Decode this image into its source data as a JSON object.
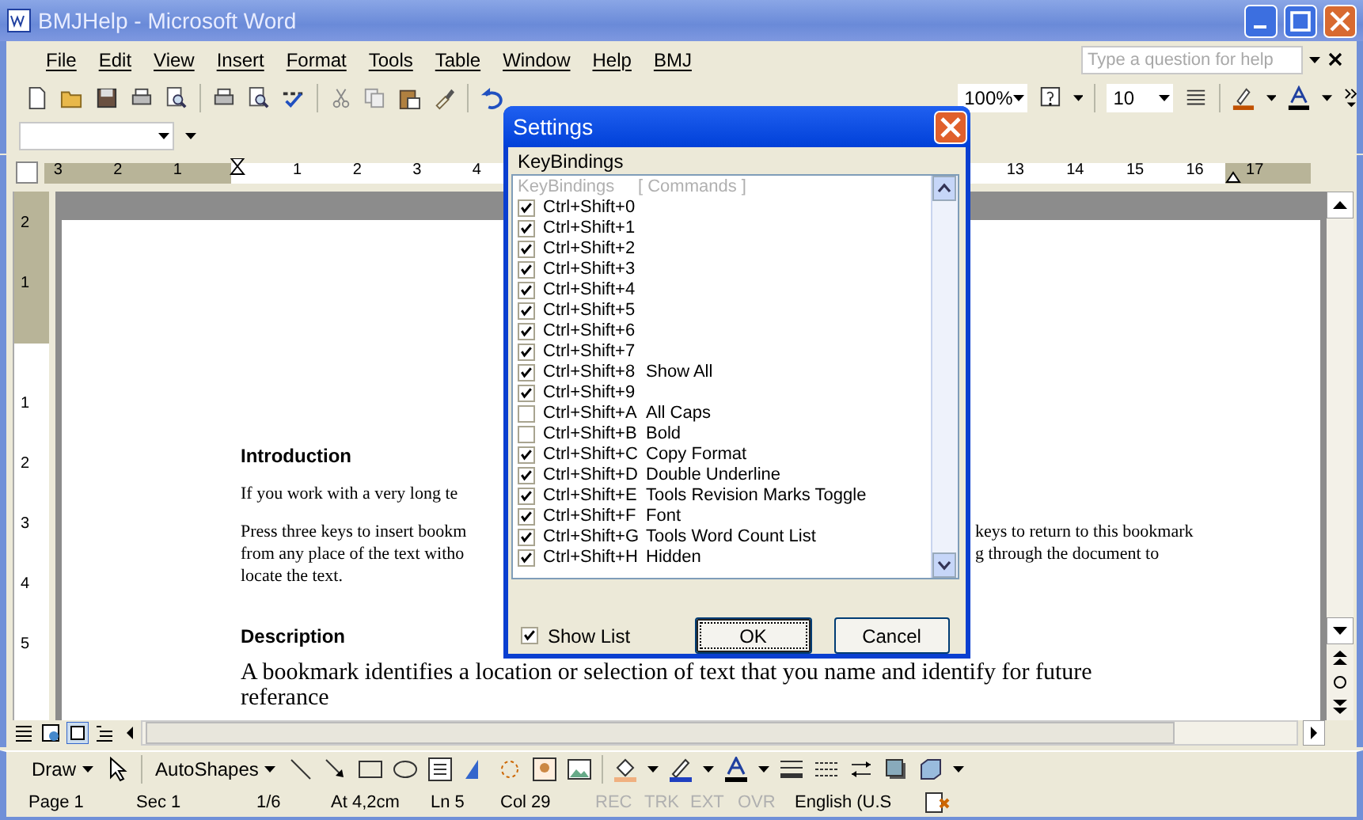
{
  "window": {
    "title": "BMJHelp - Microsoft Word"
  },
  "menu": [
    "File",
    "Edit",
    "View",
    "Insert",
    "Format",
    "Tools",
    "Table",
    "Window",
    "Help",
    "BMJ"
  ],
  "help_box": {
    "placeholder": "Type a question for help"
  },
  "toolbar": {
    "zoom": "100%",
    "font_size": "10"
  },
  "ruler": {
    "left_labels": [
      "3",
      "2",
      "1"
    ],
    "right_labels": [
      "1",
      "2",
      "3",
      "4"
    ],
    "far_labels": [
      "13",
      "14",
      "15",
      "16",
      "17"
    ]
  },
  "vertical_ruler": {
    "top_labels": [
      "2",
      "1"
    ],
    "labels": [
      "1",
      "2",
      "3",
      "4",
      "5"
    ]
  },
  "document": {
    "heading_1": "Introduction",
    "intro_line": "If you work with a very long te",
    "paragraph_lines": [
      {
        "left": "Press three keys to insert bookm",
        "right": "keys to return to this bookmark"
      },
      {
        "left": "from any place of the text witho",
        "right": "g through the document to"
      },
      {
        "left": "locate the text."
      }
    ],
    "heading_2": "Description",
    "body_line": "A bookmark identifies a location or selection of text that you name and identify for future",
    "body_line_2": "referance"
  },
  "dialog": {
    "title": "Settings",
    "group_label": "KeyBindings",
    "list_header": [
      "KeyBindings",
      "[ Commands ]"
    ],
    "rows": [
      {
        "key": "Ctrl+Shift+0",
        "checked": true
      },
      {
        "key": "Ctrl+Shift+1",
        "checked": true
      },
      {
        "key": "Ctrl+Shift+2",
        "checked": true
      },
      {
        "key": "Ctrl+Shift+3",
        "checked": true
      },
      {
        "key": "Ctrl+Shift+4",
        "checked": true
      },
      {
        "key": "Ctrl+Shift+5",
        "checked": true
      },
      {
        "key": "Ctrl+Shift+6",
        "checked": true
      },
      {
        "key": "Ctrl+Shift+7",
        "checked": true
      },
      {
        "key": "Ctrl+Shift+8",
        "command": "Show All",
        "checked": true
      },
      {
        "key": "Ctrl+Shift+9",
        "checked": true
      },
      {
        "key": "Ctrl+Shift+A",
        "command": "All Caps",
        "checked": false
      },
      {
        "key": "Ctrl+Shift+B",
        "command": "Bold",
        "checked": false
      },
      {
        "key": "Ctrl+Shift+C",
        "command": "Copy Format",
        "checked": true
      },
      {
        "key": "Ctrl+Shift+D",
        "command": "Double Underline",
        "checked": true
      },
      {
        "key": "Ctrl+Shift+E",
        "command": "Tools Revision Marks Toggle",
        "checked": true
      },
      {
        "key": "Ctrl+Shift+F",
        "command": "Font",
        "checked": true
      },
      {
        "key": "Ctrl+Shift+G",
        "command": "Tools Word Count List",
        "checked": true
      },
      {
        "key": "Ctrl+Shift+H",
        "command": "Hidden",
        "checked": true
      }
    ],
    "show_list": {
      "label": "Show List",
      "checked": true
    },
    "buttons": [
      {
        "label": "OK",
        "default": true
      },
      {
        "label": "Cancel",
        "default": false
      }
    ]
  },
  "drawing_toolbar": {
    "draw": "Draw",
    "autoshapes": "AutoShapes"
  },
  "status_bar": [
    {
      "label": "Page 1",
      "enabled": true
    },
    {
      "label": "Sec 1",
      "enabled": true
    },
    {
      "label": "1/6",
      "enabled": true
    },
    {
      "label": "At 4,2cm",
      "enabled": true
    },
    {
      "label": "Ln 5",
      "enabled": true
    },
    {
      "label": "Col 29",
      "enabled": true
    },
    {
      "label": "REC",
      "enabled": false
    },
    {
      "label": "TRK",
      "enabled": false
    },
    {
      "label": "EXT",
      "enabled": false
    },
    {
      "label": "OVR",
      "enabled": false
    },
    {
      "label": "English (U.S",
      "enabled": true
    }
  ]
}
